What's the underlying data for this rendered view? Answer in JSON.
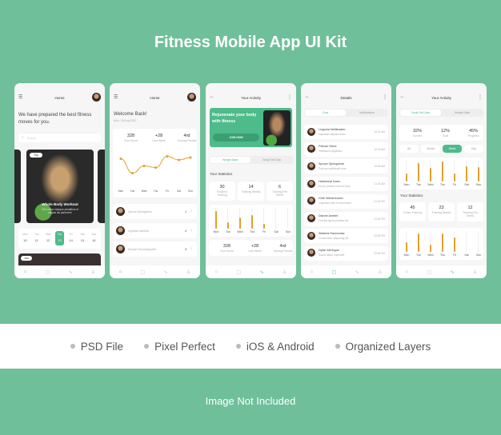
{
  "title": "Fitness Mobile App UI Kit",
  "features": [
    "PSD File",
    "Pixel Perfect",
    "iOS & Android",
    "Organized Layers"
  ],
  "footer": "Image Not Included",
  "colors": {
    "background": "#6fbf9a",
    "accent": "#4dbb8a",
    "bar": "#e0a030"
  },
  "nav_icons": [
    "home-icon",
    "chat-icon",
    "activity-icon",
    "profile-icon"
  ],
  "screen1": {
    "header": "Home",
    "headline": "We have prepared the best fitness moves for you.",
    "search_placeholder": "Search",
    "card_tag": "Top",
    "card_title": "Whole Body Workout",
    "card_desc": "Orci varius natoque penatibus et magnis dis parturient.",
    "days": [
      "Mon",
      "Tue",
      "Wed",
      "Thu",
      "Fri",
      "Sat",
      "Sun"
    ],
    "dates": [
      "10",
      "11",
      "12",
      "13",
      "14",
      "15",
      "16"
    ],
    "selected_index": 3,
    "bottom_tag": "Join"
  },
  "screen2": {
    "header": "Home",
    "welcome": "Welcome Back!",
    "date": "Mon, 29 Aug 2022",
    "stats": [
      {
        "value": "328",
        "label": "Your Score"
      },
      {
        "value": "+28",
        "label": "Last Week"
      },
      {
        "value": "4rd",
        "label": "Among Friends"
      }
    ],
    "chart_data": {
      "type": "line",
      "categories": [
        "Mon",
        "Tue",
        "Wed",
        "Thu",
        "Fri",
        "Sat",
        "Sun"
      ],
      "values": [
        0.75,
        0.15,
        0.45,
        0.38,
        0.85,
        0.7,
        0.8
      ]
    },
    "ranking": [
      {
        "name": "Spruce Springclean",
        "rank": "1"
      },
      {
        "name": "Ingredia Nutrisha",
        "rank": "2"
      },
      {
        "name": "Manuel Internetaquette",
        "rank": "3"
      }
    ]
  },
  "screen3": {
    "header": "Your Activity",
    "banner_title": "Rejuvenate your body with fitness",
    "banner_button": "JOIN NOW",
    "tabs": [
      "Weight Data",
      "Body Fat Data"
    ],
    "section": "Your Statistics",
    "stats": [
      {
        "value": "30",
        "label": "Finished Training"
      },
      {
        "value": "14",
        "label": "Training Weeks"
      },
      {
        "value": "6",
        "label": "Training Per Week"
      }
    ],
    "chart_data": {
      "type": "bar",
      "categories": [
        "Mon",
        "Tue",
        "Wed",
        "Thu",
        "Fri",
        "Sat",
        "Sun"
      ],
      "values": [
        0.85,
        0.3,
        0.55,
        0.65,
        0.25,
        0,
        0
      ]
    },
    "summary": [
      {
        "value": "328",
        "label": "Your Score"
      },
      {
        "value": "+28",
        "label": "Last Week"
      },
      {
        "value": "4rd",
        "label": "Among Friends"
      }
    ]
  },
  "screen4": {
    "header": "Details",
    "tabs": [
      "Chat",
      "Notifications"
    ],
    "chats": [
      {
        "name": "Linguina Nettlewater",
        "msg": "Imperdiet aliquam tellus",
        "time": "10:21 AM"
      },
      {
        "name": "Pelican Steve",
        "msg": "Vestibulum dignissim",
        "time": "10:24 AM"
      },
      {
        "name": "Spruce Springclean",
        "msg": "Proin ac sollicitudin eros",
        "time": "10:55 AM"
      },
      {
        "name": "Hathaneal Down",
        "msg": "Donec pretium risus id risus",
        "time": "11:01 AM"
      },
      {
        "name": "Girth Wiedenbauer",
        "msg": "Vulputate nulla mi accumsan",
        "time": "01:34 PM"
      },
      {
        "name": "Dianne Ameter",
        "msg": "Gravida ligula pharetra vel",
        "time": "01:45 PM"
      },
      {
        "name": "Wisteria Ravenclaw",
        "msg": "Consectetur adipiscing elit",
        "time": "03:45 PM"
      },
      {
        "name": "Dylan Meringue",
        "msg": "Suspendisse imperdiet",
        "time": "03:49 PM"
      }
    ]
  },
  "screen5": {
    "header": "Your Activity",
    "tabs": [
      "Body Fat Data",
      "Weight Data"
    ],
    "stats": [
      {
        "value": "32%",
        "label": "Current"
      },
      {
        "value": "12%",
        "label": "Goal"
      },
      {
        "value": "45%",
        "label": "Progress"
      }
    ],
    "filters": [
      "All",
      "Month",
      "Week",
      "Day"
    ],
    "selected_filter": 2,
    "section": "Your Statistics",
    "stats2": [
      {
        "value": "45",
        "label": "Finish Training"
      },
      {
        "value": "23",
        "label": "Training Weeks"
      },
      {
        "value": "12",
        "label": "Training Per Week"
      }
    ],
    "chart_data": [
      {
        "type": "bar",
        "categories": [
          "Mon",
          "Tue",
          "Wed",
          "Thu",
          "Fri",
          "Sat",
          "Sun"
        ],
        "values": [
          0.4,
          0.9,
          0.65,
          0.95,
          0.4,
          0.75,
          0.7
        ]
      },
      {
        "type": "bar",
        "categories": [
          "Mon",
          "Tue",
          "Wed",
          "Thu",
          "Fri",
          "Sat",
          "Sun"
        ],
        "values": [
          0.45,
          0.9,
          0.35,
          0.9,
          0.7,
          0,
          0
        ]
      }
    ]
  }
}
